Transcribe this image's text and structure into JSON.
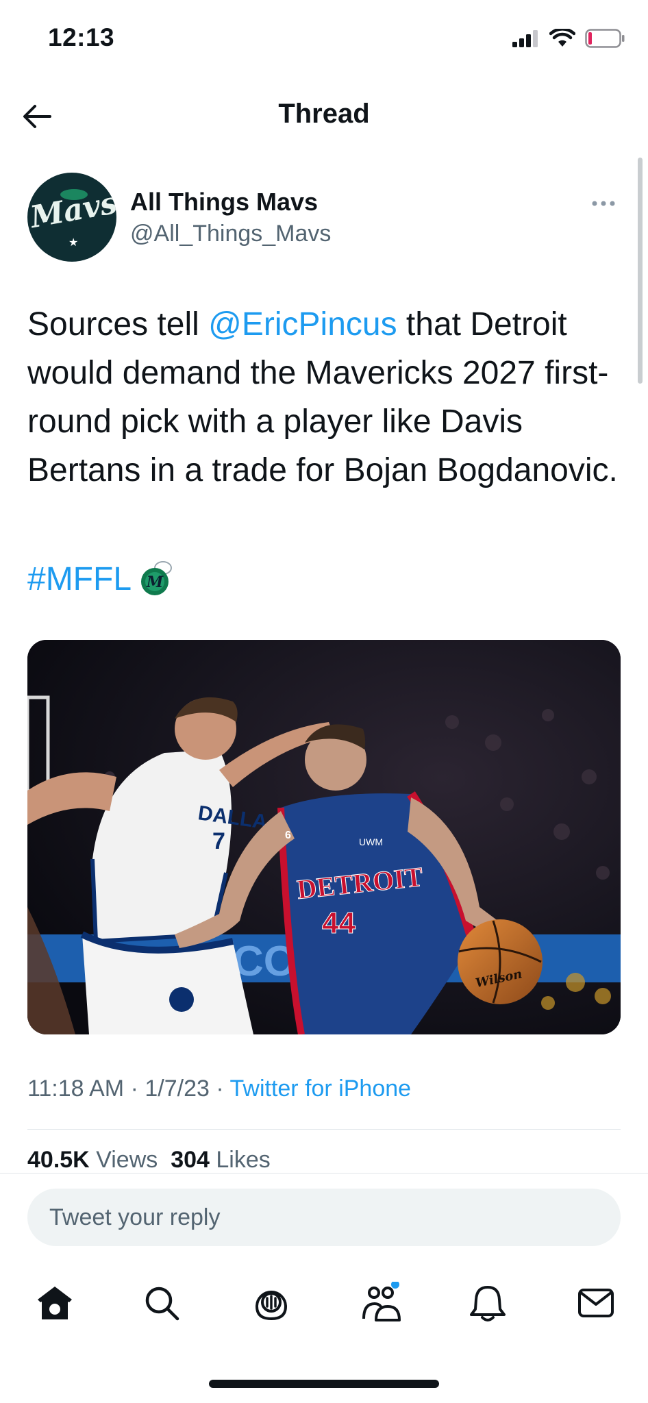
{
  "status_bar": {
    "time": "12:13"
  },
  "header": {
    "title": "Thread"
  },
  "tweet": {
    "author_name": "All Things Mavs",
    "author_handle": "@All_Things_Mavs",
    "avatar_text": "Mavs",
    "text_before_mention": "Sources tell ",
    "mention": "@EricPincus",
    "text_after_mention": " that Detroit would demand the Mavericks 2027 first-round pick with a player like Davis Bertans in a trade for Bojan Bogdanovic.",
    "hashtag": "#MFFL",
    "media": {
      "left_jersey_text": "DALLA",
      "left_jersey_number": "7",
      "right_jersey_text": "DETROIT",
      "right_jersey_number": "44",
      "ball_text": "Wilson",
      "sponsor_text": "UWM",
      "arena_sign_text": "COI"
    },
    "time": "11:18 AM",
    "separator": " · ",
    "date": "1/7/23",
    "source": "Twitter for iPhone",
    "views_count": "40.5K",
    "views_label": "Views",
    "likes_count": "304",
    "likes_label": "Likes"
  },
  "reply": {
    "placeholder": "Tweet your reply"
  },
  "tab_bar": {
    "icons": [
      "home-icon",
      "search-icon",
      "spaces-icon",
      "communities-icon",
      "notifications-icon",
      "messages-icon"
    ]
  },
  "colors": {
    "accent": "#1d9bf0",
    "text": "#0f1419",
    "muted": "#536471",
    "battery_low": "#e0245e"
  }
}
